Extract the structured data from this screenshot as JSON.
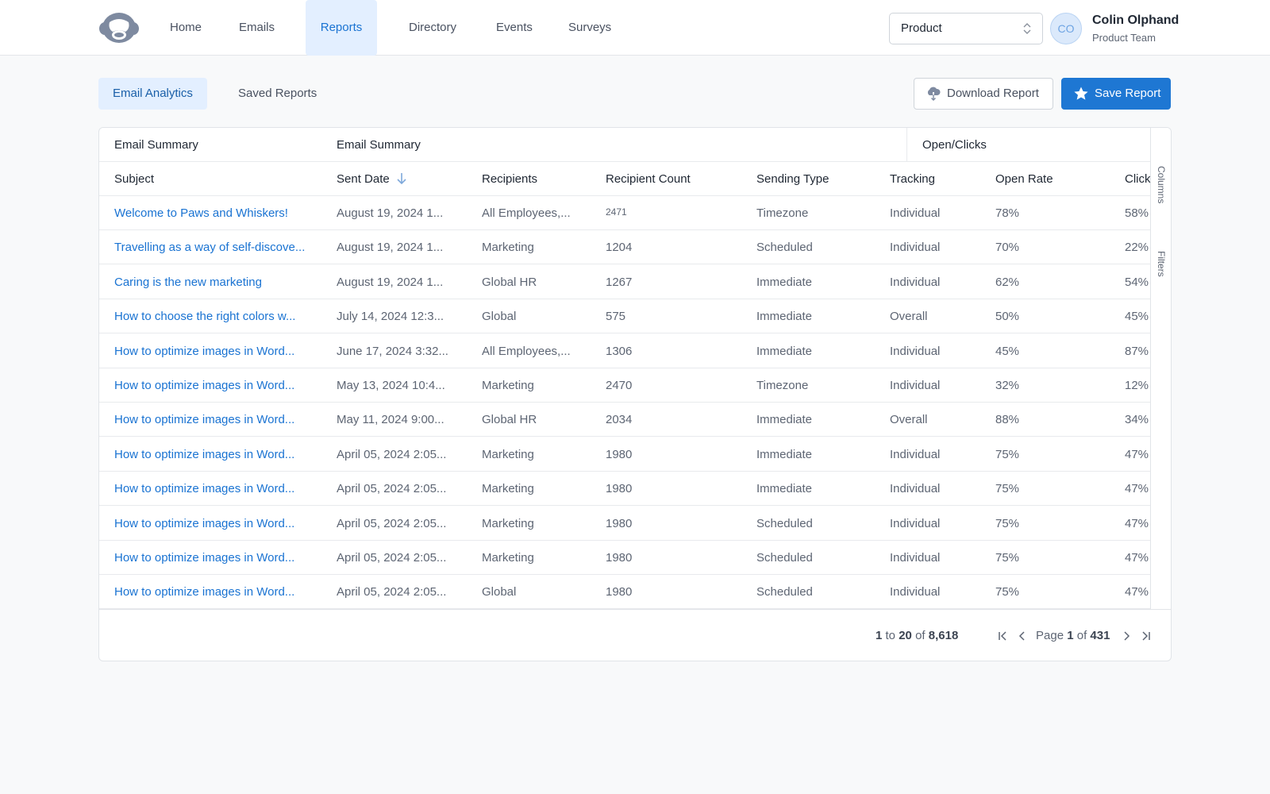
{
  "nav": {
    "items": [
      {
        "label": "Home"
      },
      {
        "label": "Emails"
      },
      {
        "label": "Reports",
        "active": true
      },
      {
        "label": "Directory"
      },
      {
        "label": "Events"
      },
      {
        "label": "Surveys"
      }
    ],
    "workspace_select": {
      "value": "Product"
    },
    "user": {
      "initials": "CO",
      "name": "Colin Olphand",
      "team": "Product Team"
    }
  },
  "subtabs": [
    {
      "label": "Email Analytics",
      "active": true
    },
    {
      "label": "Saved Reports"
    }
  ],
  "actions": {
    "download_label": "Download Report",
    "save_label": "Save Report"
  },
  "table": {
    "group_headers": [
      "Email Summary",
      "Email Summary",
      "Open/Clicks"
    ],
    "columns": [
      "Subject",
      "Sent Date",
      "Recipients",
      "Recipient Count",
      "Sending Type",
      "Tracking",
      "Open Rate",
      "Click"
    ],
    "sorted_column": "Sent Date",
    "sort_direction": "descending",
    "rows": [
      [
        "Welcome to Paws and Whiskers!",
        "August 19, 2024 1...",
        "All Employees,...",
        "2471",
        "Timezone",
        "Individual",
        "78%",
        "58%"
      ],
      [
        "Travelling as a way of self-discove...",
        "August 19, 2024 1...",
        "Marketing",
        "1204",
        "Scheduled",
        "Individual",
        "70%",
        "22%"
      ],
      [
        "Caring is the new marketing",
        "August 19, 2024 1...",
        "Global HR",
        "1267",
        "Immediate",
        "Individual",
        "62%",
        "54%"
      ],
      [
        "How to choose the right colors w...",
        "July 14, 2024 12:3...",
        "Global",
        "575",
        "Immediate",
        "Overall",
        "50%",
        "45%"
      ],
      [
        "How to optimize images in Word...",
        "June 17, 2024 3:32...",
        "All Employees,...",
        "1306",
        "Immediate",
        "Individual",
        "45%",
        "87%"
      ],
      [
        "How to optimize images in Word...",
        "May 13, 2024 10:4...",
        "Marketing",
        "2470",
        "Timezone",
        "Individual",
        "32%",
        "12%"
      ],
      [
        "How to optimize images in Word...",
        "May 11, 2024 9:00...",
        "Global HR",
        "2034",
        "Immediate",
        "Overall",
        "88%",
        "34%"
      ],
      [
        "How to optimize images in Word...",
        "April 05, 2024 2:05...",
        "Marketing",
        "1980",
        "Immediate",
        "Individual",
        "75%",
        "47%"
      ],
      [
        "How to optimize images in Word...",
        "April 05, 2024 2:05...",
        "Marketing",
        "1980",
        "Immediate",
        "Individual",
        "75%",
        "47%"
      ],
      [
        "How to optimize images in Word...",
        "April 05, 2024 2:05...",
        "Marketing",
        "1980",
        "Scheduled",
        "Individual",
        "75%",
        "47%"
      ],
      [
        "How to optimize images in Word...",
        "April 05, 2024 2:05...",
        "Marketing",
        "1980",
        "Scheduled",
        "Individual",
        "75%",
        "47%"
      ],
      [
        "How to optimize images in Word...",
        "April 05, 2024 2:05...",
        "Global",
        "1980",
        "Scheduled",
        "Individual",
        "75%",
        "47%"
      ]
    ],
    "side_panel": [
      "Columns",
      "Filters"
    ]
  },
  "pagination": {
    "range_start": "1",
    "to_label": "to",
    "range_end": "20",
    "of_label": "of",
    "total": "8,618",
    "page_label": "Page",
    "current_page": "1",
    "page_of_label": "of",
    "page_count": "431"
  },
  "icons": [
    "logo-icon",
    "chevron-updown-icon",
    "cloud-download-icon",
    "star-icon",
    "arrow-down-icon",
    "first-page-icon",
    "prev-page-icon",
    "next-page-icon",
    "last-page-icon"
  ],
  "colors": {
    "accent": "#1e77d3",
    "link": "#1a73d2",
    "active_tab_bg": "#e3efff"
  }
}
